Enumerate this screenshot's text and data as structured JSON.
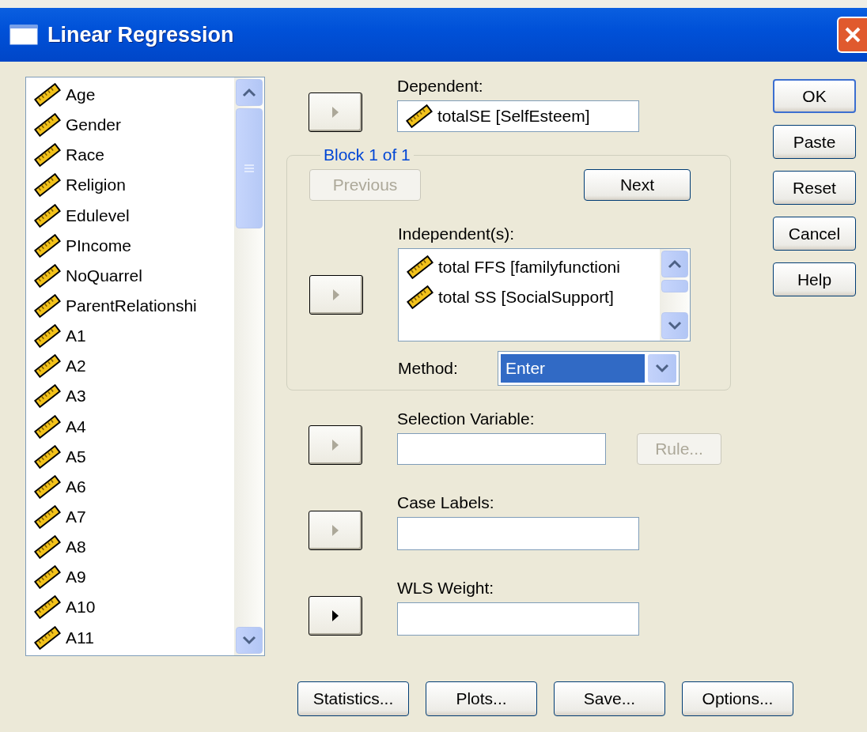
{
  "window": {
    "title": "Linear Regression"
  },
  "variables": [
    "Age",
    "Gender",
    "Race",
    "Religion",
    "Edulevel",
    "PIncome",
    "NoQuarrel",
    "ParentRelationshi",
    "A1",
    "A2",
    "A3",
    "A4",
    "A5",
    "A6",
    "A7",
    "A8",
    "A9",
    "A10",
    "A11"
  ],
  "dependent": {
    "label": "Dependent:",
    "arrow_disabled": true,
    "value": "totalSE [SelfEsteem]"
  },
  "block": {
    "title": "Block 1 of 1",
    "previous": {
      "label": "Previous",
      "disabled": true
    },
    "next": {
      "label": "Next",
      "disabled": false
    },
    "independent_label": "Independent(s):",
    "arrow_disabled": true,
    "independents": [
      "total FFS [familyfunctioni",
      "total SS [SocialSupport]"
    ],
    "method_label": "Method:",
    "method": "Enter"
  },
  "selection": {
    "label": "Selection Variable:",
    "arrow_disabled": true,
    "rule": {
      "label": "Rule...",
      "disabled": true
    }
  },
  "case_labels": {
    "label": "Case Labels:",
    "arrow_disabled": true
  },
  "wls": {
    "label": "WLS Weight:",
    "arrow_disabled": false
  },
  "side_buttons": [
    {
      "label": "OK",
      "default": true
    },
    {
      "label": "Paste",
      "default": false
    },
    {
      "label": "Reset",
      "default": false
    },
    {
      "label": "Cancel",
      "default": false
    },
    {
      "label": "Help",
      "default": false
    }
  ],
  "bottom_buttons": [
    "Statistics...",
    "Plots...",
    "Save...",
    "Options..."
  ]
}
